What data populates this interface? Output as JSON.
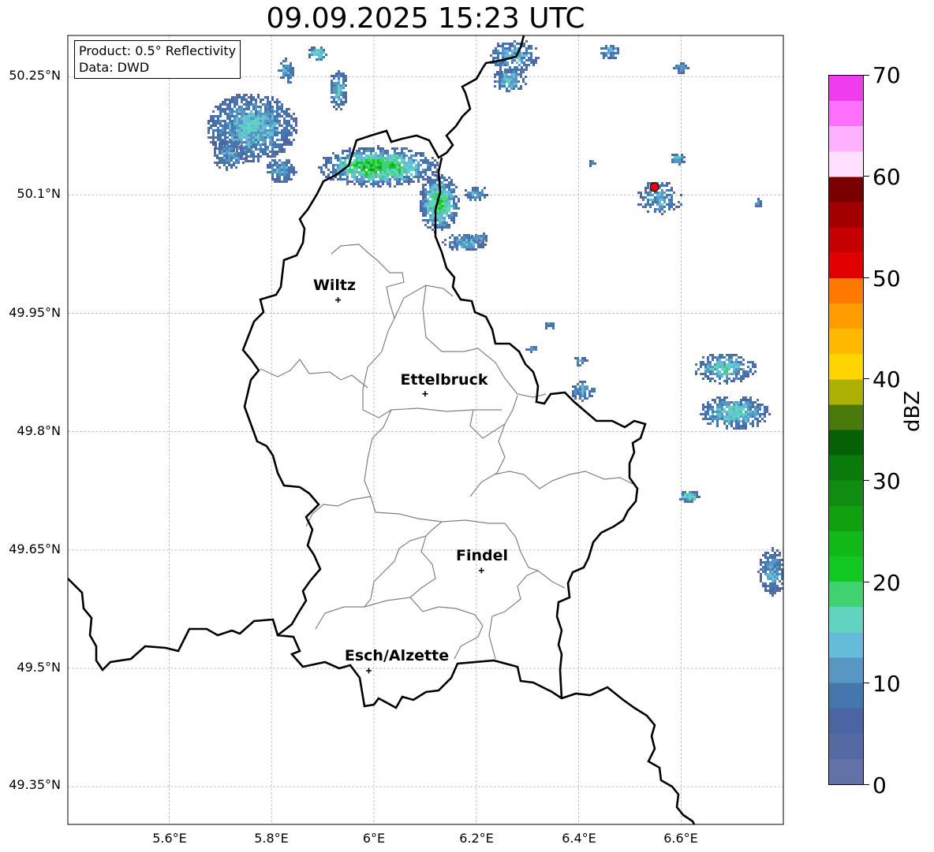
{
  "title": "09.09.2025 15:23 UTC",
  "info": {
    "product": "Product: 0.5° Reflectivity",
    "source": "Data: DWD"
  },
  "lat_ticks": [
    "50.25°N",
    "50.1°N",
    "49.95°N",
    "49.8°N",
    "49.65°N",
    "49.5°N",
    "49.35°N"
  ],
  "lon_ticks": [
    "5.6°E",
    "5.8°E",
    "6°E",
    "6.2°E",
    "6.4°E",
    "6.6°E"
  ],
  "cities": [
    {
      "name": "Wiltz",
      "lon": 5.93,
      "lat": 49.967
    },
    {
      "name": "Ettelbruck",
      "lon": 6.1,
      "lat": 49.848
    },
    {
      "name": "Findel",
      "lon": 6.21,
      "lat": 49.624
    },
    {
      "name": "Esch/Alzette",
      "lon": 5.99,
      "lat": 49.497
    }
  ],
  "radar_site": {
    "lon": 6.548,
    "lat": 50.11,
    "color": "#e8000b"
  },
  "colorbar": {
    "label": "dBZ",
    "min": 0,
    "max": 70,
    "ticks": [
      "0",
      "10",
      "20",
      "30",
      "40",
      "50",
      "60",
      "70"
    ],
    "colors": [
      "#6272a8",
      "#556aa4",
      "#4a64a4",
      "#4576ae",
      "#5896c4",
      "#64bcd8",
      "#60d4c0",
      "#40d270",
      "#10c820",
      "#10b818",
      "#10a010",
      "#108c10",
      "#0a7a0a",
      "#066006",
      "#4a7a0a",
      "#acb004",
      "#ffd400",
      "#ffb800",
      "#ff9c00",
      "#ff7800",
      "#e00000",
      "#c40000",
      "#a20000",
      "#7a0000",
      "#ffe0ff",
      "#ffb0ff",
      "#ff70ff",
      "#ee3cee"
    ]
  },
  "colors": {
    "border": "#000000",
    "admin": "#808080",
    "grid": "#b4b4b4"
  }
}
